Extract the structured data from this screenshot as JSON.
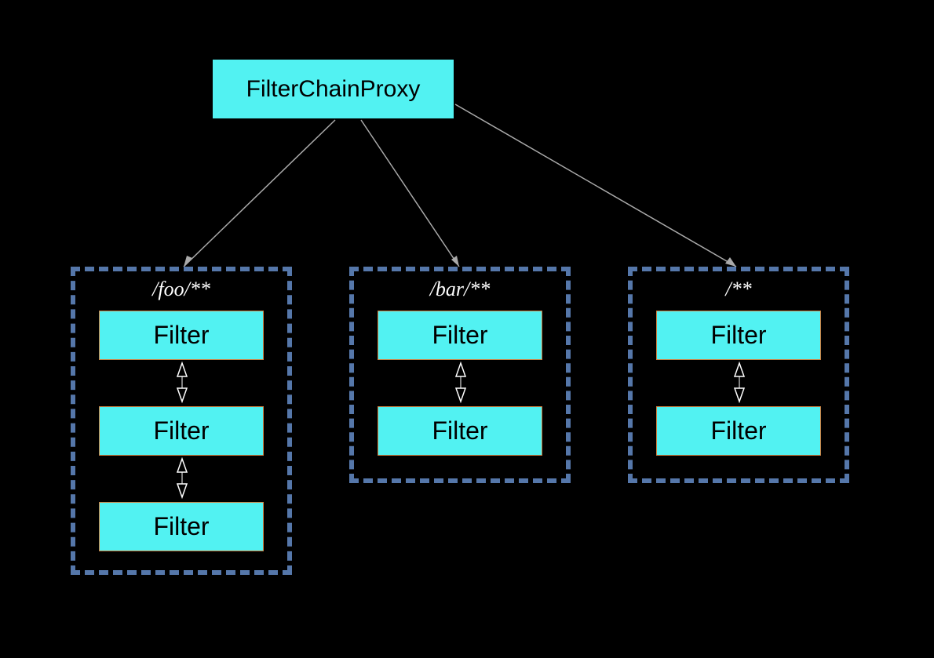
{
  "proxy": {
    "label": "FilterChainProxy"
  },
  "groups": [
    {
      "label": "/foo/**",
      "filters": [
        "Filter",
        "Filter",
        "Filter"
      ]
    },
    {
      "label": "/bar/**",
      "filters": [
        "Filter",
        "Filter"
      ]
    },
    {
      "label": "/**",
      "filters": [
        "Filter",
        "Filter"
      ]
    }
  ]
}
